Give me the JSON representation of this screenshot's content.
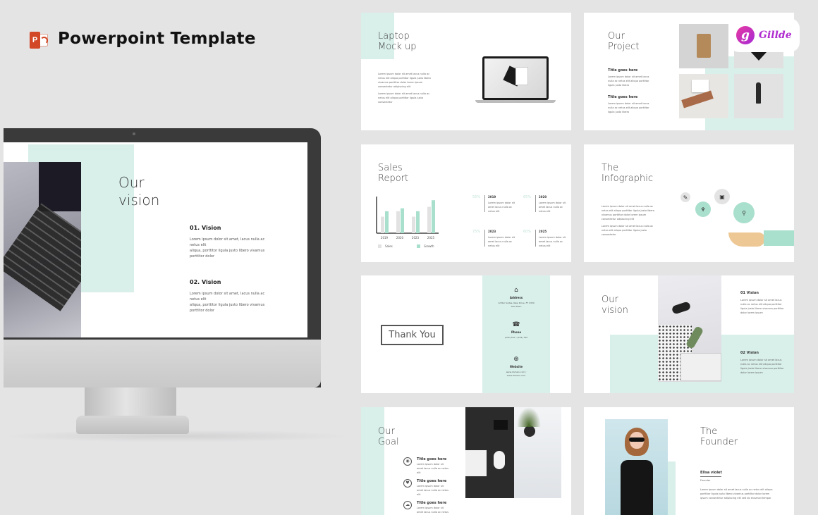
{
  "header": {
    "app_icon": "powerpoint-icon",
    "app_icon_letter": "P",
    "title": "Powerpoint Template"
  },
  "brand": {
    "logo_letter": "g",
    "name": "Gillde"
  },
  "colors": {
    "mint": "#d9f0ea",
    "mint_strong": "#9ddac7",
    "ppt_red": "#d24726",
    "brand_pink": "#e83aa0",
    "brand_purple": "#a52ad6",
    "background": "#e4e4e5"
  },
  "monitor_slide": {
    "title_line1": "Our",
    "title_line2": "vision",
    "sections": [
      {
        "heading": "01. Vision",
        "line1": "Lorem ipsum dolor sit amet, lacus nulla ac netus elit",
        "line2": "aliqua, porttitor ligula justo libero vivamus porttitor dolor"
      },
      {
        "heading": "02. Vision",
        "line1": "Lorem ipsum dolor sit amet, lacus nulla ac netus elit",
        "line2": "aliqua, porttitor ligula justo libero vivamus porttitor dolor"
      }
    ]
  },
  "slides": {
    "laptop": {
      "title_line1": "Laptop",
      "title_line2": "Mock up",
      "para1": "Lorem ipsum dolor sit amet lacus nulla ac netus elit aliqua porttitor ligula justo libero vivamus porttitor dolor lorem ipsum consectetur adipiscing elit",
      "para2": "Lorem ipsum dolor sit amet lacus nulla ac netus elit aliqua porttitor ligula justo consectetur"
    },
    "project": {
      "title_line1": "Our",
      "title_line2": "Project",
      "items": [
        {
          "heading": "Title goes here",
          "text": "Lorem ipsum dolor sit amet lacus nulla ac netus elit aliqua porttitor ligula justo libero"
        },
        {
          "heading": "Title goes here",
          "text": "Lorem ipsum dolor sit amet lacus nulla ac netus elit aliqua porttitor ligula justo libero"
        }
      ]
    },
    "sales": {
      "title_line1": "Sales",
      "title_line2": "Report",
      "stats": [
        {
          "percent": "55%",
          "year": "2019",
          "text": "Lorem ipsum dolor sit amet lacus nulla ac netus elit"
        },
        {
          "percent": "65%",
          "year": "2020",
          "text": "Lorem ipsum dolor sit amet lacus nulla ac netus elit"
        },
        {
          "percent": "75%",
          "year": "2023",
          "text": "Lorem ipsum dolor sit amet lacus nulla ac netus elit"
        },
        {
          "percent": "60%",
          "year": "2025",
          "text": "Lorem ipsum dolor sit amet lacus nulla ac netus elit"
        }
      ]
    },
    "infographic": {
      "title_line1": "The",
      "title_line2": "Infographic",
      "para1": "Lorem ipsum dolor sit amet lacus nulla ac netus elit aliqua porttitor ligula justo libero vivamus porttitor dolor lorem ipsum consectetur adipiscing elit",
      "para2": "Lorem ipsum dolor sit amet lacus nulla ac netus elit aliqua porttitor ligula justo consectetur",
      "gears": [
        {
          "icon": "pencil-icon",
          "glyph": "✎"
        },
        {
          "icon": "trophy-icon",
          "glyph": "♆"
        },
        {
          "icon": "briefcase-icon",
          "glyph": "▣"
        },
        {
          "icon": "chart-icon",
          "glyph": "⚲"
        }
      ]
    },
    "thankyou": {
      "label": "Thank You",
      "contacts": [
        {
          "icon": "home-icon",
          "glyph": "⌂",
          "label": "Address",
          "value": "12 Bar Suites, New Drive, FT 2350 Asia Town"
        },
        {
          "icon": "phone-icon",
          "glyph": "☎",
          "label": "Phone",
          "value": "(234) 567 / (234) 765"
        },
        {
          "icon": "globe-icon",
          "glyph": "⊕",
          "label": "Website",
          "value": "www.domain.com / www.domain.com"
        }
      ]
    },
    "vision2": {
      "title_line1": "Our",
      "title_line2": "vision",
      "sections": [
        {
          "heading": "01 Vision",
          "text": "Lorem ipsum dolor sit amet lacus nulla ac netus elit aliqua porttitor ligula justo libero vivamus porttitor dolor lorem ipsum"
        },
        {
          "heading": "02 Vision",
          "text": "Lorem ipsum dolor sit amet lacus nulla ac netus elit aliqua porttitor ligula justo libero vivamus porttitor dolor lorem ipsum"
        }
      ]
    },
    "goal": {
      "title_line1": "Our",
      "title_line2": "Goal",
      "items": [
        {
          "icon": "megaphone-icon",
          "glyph": "◉",
          "heading": "Title goes here",
          "text": "Lorem ipsum dolor sit amet lacus nulla ac netus elit"
        },
        {
          "icon": "heart-icon",
          "glyph": "♥",
          "heading": "Title goes here",
          "text": "Lorem ipsum dolor sit amet lacus nulla ac netus elit"
        },
        {
          "icon": "cloud-icon",
          "glyph": "☁",
          "heading": "Title goes here",
          "text": "Lorem ipsum dolor sit amet lacus nulla ac netus elit"
        }
      ]
    },
    "founder": {
      "title_line1": "The",
      "title_line2": "Founder",
      "name": "Ellsa violet",
      "role": "Founder",
      "text": "Lorem ipsum dolor sit amet lacus nulla ac netus elit aliqua porttitor ligula justo libero vivamus porttitor dolor lorem ipsum consectetur adipiscing elit sed do eiusmod tempor"
    }
  },
  "chart_data": {
    "type": "bar",
    "title": "Sales Report",
    "categories": [
      "2019",
      "2020",
      "2023",
      "2025"
    ],
    "series": [
      {
        "name": "Sales",
        "values": [
          45,
          60,
          45,
          72
        ]
      },
      {
        "name": "Growth",
        "values": [
          60,
          68,
          60,
          90
        ]
      }
    ],
    "xlabel": "",
    "ylabel": "",
    "ylim": [
      0,
      100
    ],
    "legend": "bottom",
    "grid": false
  }
}
